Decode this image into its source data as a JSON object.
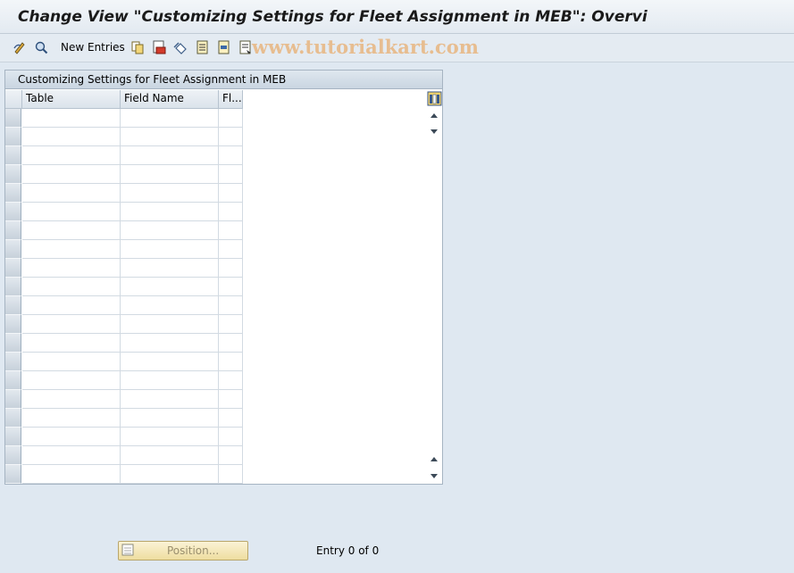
{
  "window": {
    "title": "Change View \"Customizing Settings for Fleet Assignment in MEB\": Overvi"
  },
  "toolbar": {
    "new_entries_label": "New Entries",
    "watermark": "www.tutorialkart.com",
    "icons": [
      "display-change-icon",
      "where-used-icon",
      "copy-icon",
      "delete-icon",
      "undo-icon",
      "select-all-icon",
      "select-block-icon",
      "deselect-all-icon"
    ]
  },
  "table": {
    "panel_title": "Customizing Settings for Fleet Assignment in MEB",
    "columns": [
      "Table",
      "Field Name",
      "Fl..."
    ],
    "rows": [
      [
        "",
        "",
        ""
      ],
      [
        "",
        "",
        ""
      ],
      [
        "",
        "",
        ""
      ],
      [
        "",
        "",
        ""
      ],
      [
        "",
        "",
        ""
      ],
      [
        "",
        "",
        ""
      ],
      [
        "",
        "",
        ""
      ],
      [
        "",
        "",
        ""
      ],
      [
        "",
        "",
        ""
      ],
      [
        "",
        "",
        ""
      ],
      [
        "",
        "",
        ""
      ],
      [
        "",
        "",
        ""
      ],
      [
        "",
        "",
        ""
      ],
      [
        "",
        "",
        ""
      ],
      [
        "",
        "",
        ""
      ],
      [
        "",
        "",
        ""
      ],
      [
        "",
        "",
        ""
      ],
      [
        "",
        "",
        ""
      ],
      [
        "",
        "",
        ""
      ],
      [
        "",
        "",
        ""
      ]
    ]
  },
  "footer": {
    "position_label": "Position...",
    "entry_text": "Entry 0 of 0"
  },
  "colors": {
    "background": "#dfe8f1",
    "watermark": "#e8b680",
    "button_fill": "#eedd9f"
  }
}
